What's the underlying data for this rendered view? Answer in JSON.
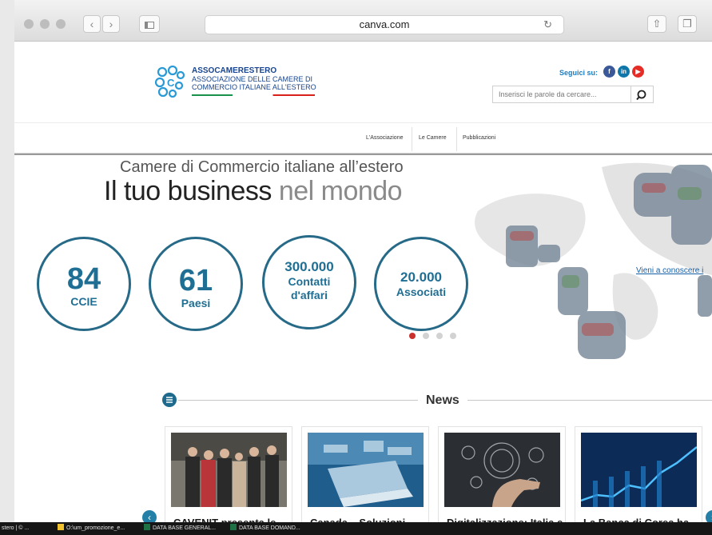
{
  "browser": {
    "url": "canva.com",
    "icons": [
      "close-dot",
      "minimize-dot",
      "zoom-dot",
      "back-icon",
      "forward-icon",
      "sidebar-icon",
      "reload-icon",
      "share-icon",
      "tabs-icon"
    ]
  },
  "header": {
    "logo_line1": "ASSOCAMERESTERO",
    "logo_line2": "ASSOCIAZIONE DELLE CAMERE DI",
    "logo_line3": "COMMERCIO ITALIANE ALL'ESTERO",
    "follow_label": "Seguici su:",
    "social": [
      {
        "icon": "facebook-icon",
        "glyph": "f",
        "color": "#3b5998"
      },
      {
        "icon": "linkedin-icon",
        "glyph": "in",
        "color": "#0e76a8"
      },
      {
        "icon": "youtube-icon",
        "glyph": "▶",
        "color": "#e52d27"
      }
    ],
    "search_placeholder": "Inserisci le parole da cercare..."
  },
  "nav": {
    "items": [
      "L'Associazione",
      "Le Camere",
      "Pubblicazioni"
    ]
  },
  "hero": {
    "subtitle": "Camere di Commercio italiane all’estero",
    "title_dark": "Il tuo business",
    "title_light": "nel mondo",
    "stats": [
      {
        "value": "84",
        "label": "CCIE"
      },
      {
        "value": "61",
        "label": "Paesi"
      },
      {
        "value": "300.000",
        "label_line1": "Contatti",
        "label_line2": "d'affari"
      },
      {
        "value": "20.000",
        "label": "Associati"
      }
    ],
    "link_text": "Vieni a conoscere i",
    "slider": {
      "count": 4,
      "active": 0,
      "active_color": "#c9302c"
    }
  },
  "news": {
    "heading": "News",
    "cards": [
      {
        "title": "CAVENIT presenta le"
      },
      {
        "title": "Canada – Soluzioni"
      },
      {
        "title": "Digitalizzazione: Italia e"
      },
      {
        "title": "La Banca di Corea ha"
      }
    ]
  },
  "taskbar": {
    "items": [
      {
        "label": "stero | © ..."
      },
      {
        "label": "O:\\um_promozione_e..."
      },
      {
        "label": "DATA BASE GENERAL..."
      },
      {
        "label": "DATA BASE DOMAND..."
      }
    ]
  }
}
